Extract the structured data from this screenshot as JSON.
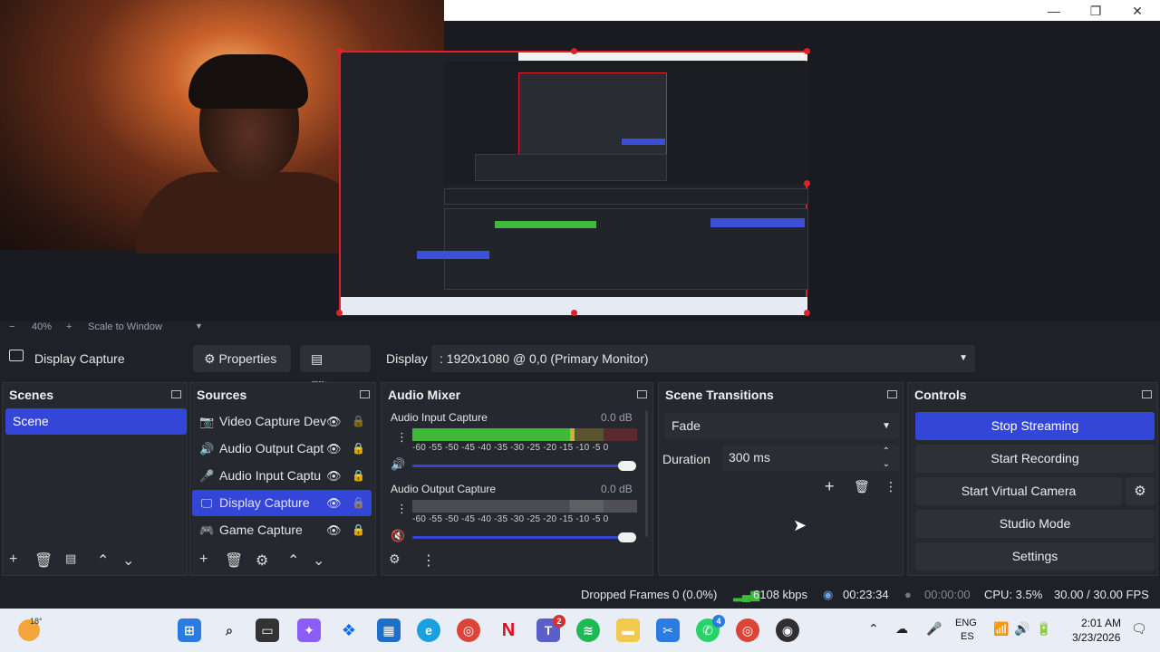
{
  "window": {
    "minimize_glyph": "—",
    "restore_glyph": "❐",
    "close_glyph": "✕"
  },
  "preview": {
    "zoom_minus": "−",
    "zoom_level": "40%",
    "zoom_plus": "+",
    "scale_mode": "Scale to Window"
  },
  "source_toolbar": {
    "selected_source": "Display Capture",
    "properties_label": "Properties",
    "filters_label": "Filters",
    "display_label": "Display",
    "display_value": ": 1920x1080 @ 0,0 (Primary Monitor)"
  },
  "scenes": {
    "title": "Scenes",
    "items": [
      "Scene"
    ]
  },
  "sources": {
    "title": "Sources",
    "items": [
      {
        "label": "Video Capture Dev",
        "icon": "camera-icon"
      },
      {
        "label": "Audio Output Capt",
        "icon": "speaker-icon"
      },
      {
        "label": "Audio Input Captu",
        "icon": "microphone-icon"
      },
      {
        "label": "Display Capture",
        "icon": "monitor-icon"
      },
      {
        "label": "Game Capture",
        "icon": "gamepad-icon"
      }
    ]
  },
  "audio_mixer": {
    "title": "Audio Mixer",
    "channels": [
      {
        "name": "Audio Input Capture",
        "db": "0.0 dB",
        "level": 0.72,
        "muted": false
      },
      {
        "name": "Audio Output Capture",
        "db": "0.0 dB",
        "level": 0.0,
        "muted": true
      }
    ],
    "ticks": "-60  -55  -50  -45  -40  -35  -30  -25  -20  -15  -10  -5   0"
  },
  "scene_transitions": {
    "title": "Scene Transitions",
    "transition": "Fade",
    "duration_label": "Duration",
    "duration_value": "300 ms"
  },
  "controls": {
    "title": "Controls",
    "stop_streaming": "Stop Streaming",
    "start_recording": "Start Recording",
    "start_virtual_camera": "Start Virtual Camera",
    "studio_mode": "Studio Mode",
    "settings": "Settings"
  },
  "status": {
    "dropped_frames": "Dropped Frames 0 (0.0%)",
    "bitrate": "6108 kbps",
    "stream_time": "00:23:34",
    "record_time": "00:00:00",
    "cpu": "CPU: 3.5%",
    "fps": "30.00 / 30.00 FPS"
  },
  "taskbar": {
    "weather": "18°",
    "teams_badge": "2",
    "whatsapp_badge": "4",
    "lang_top": "ENG",
    "lang_bottom": "ES",
    "time": "2:01 AM",
    "date": "3/23/2026"
  },
  "colors": {
    "accent": "#3446d8",
    "selection_border": "#e0202a",
    "meter_green": "#3fb93a",
    "meter_yellow": "#c9b23a",
    "meter_red": "#b8343a"
  }
}
